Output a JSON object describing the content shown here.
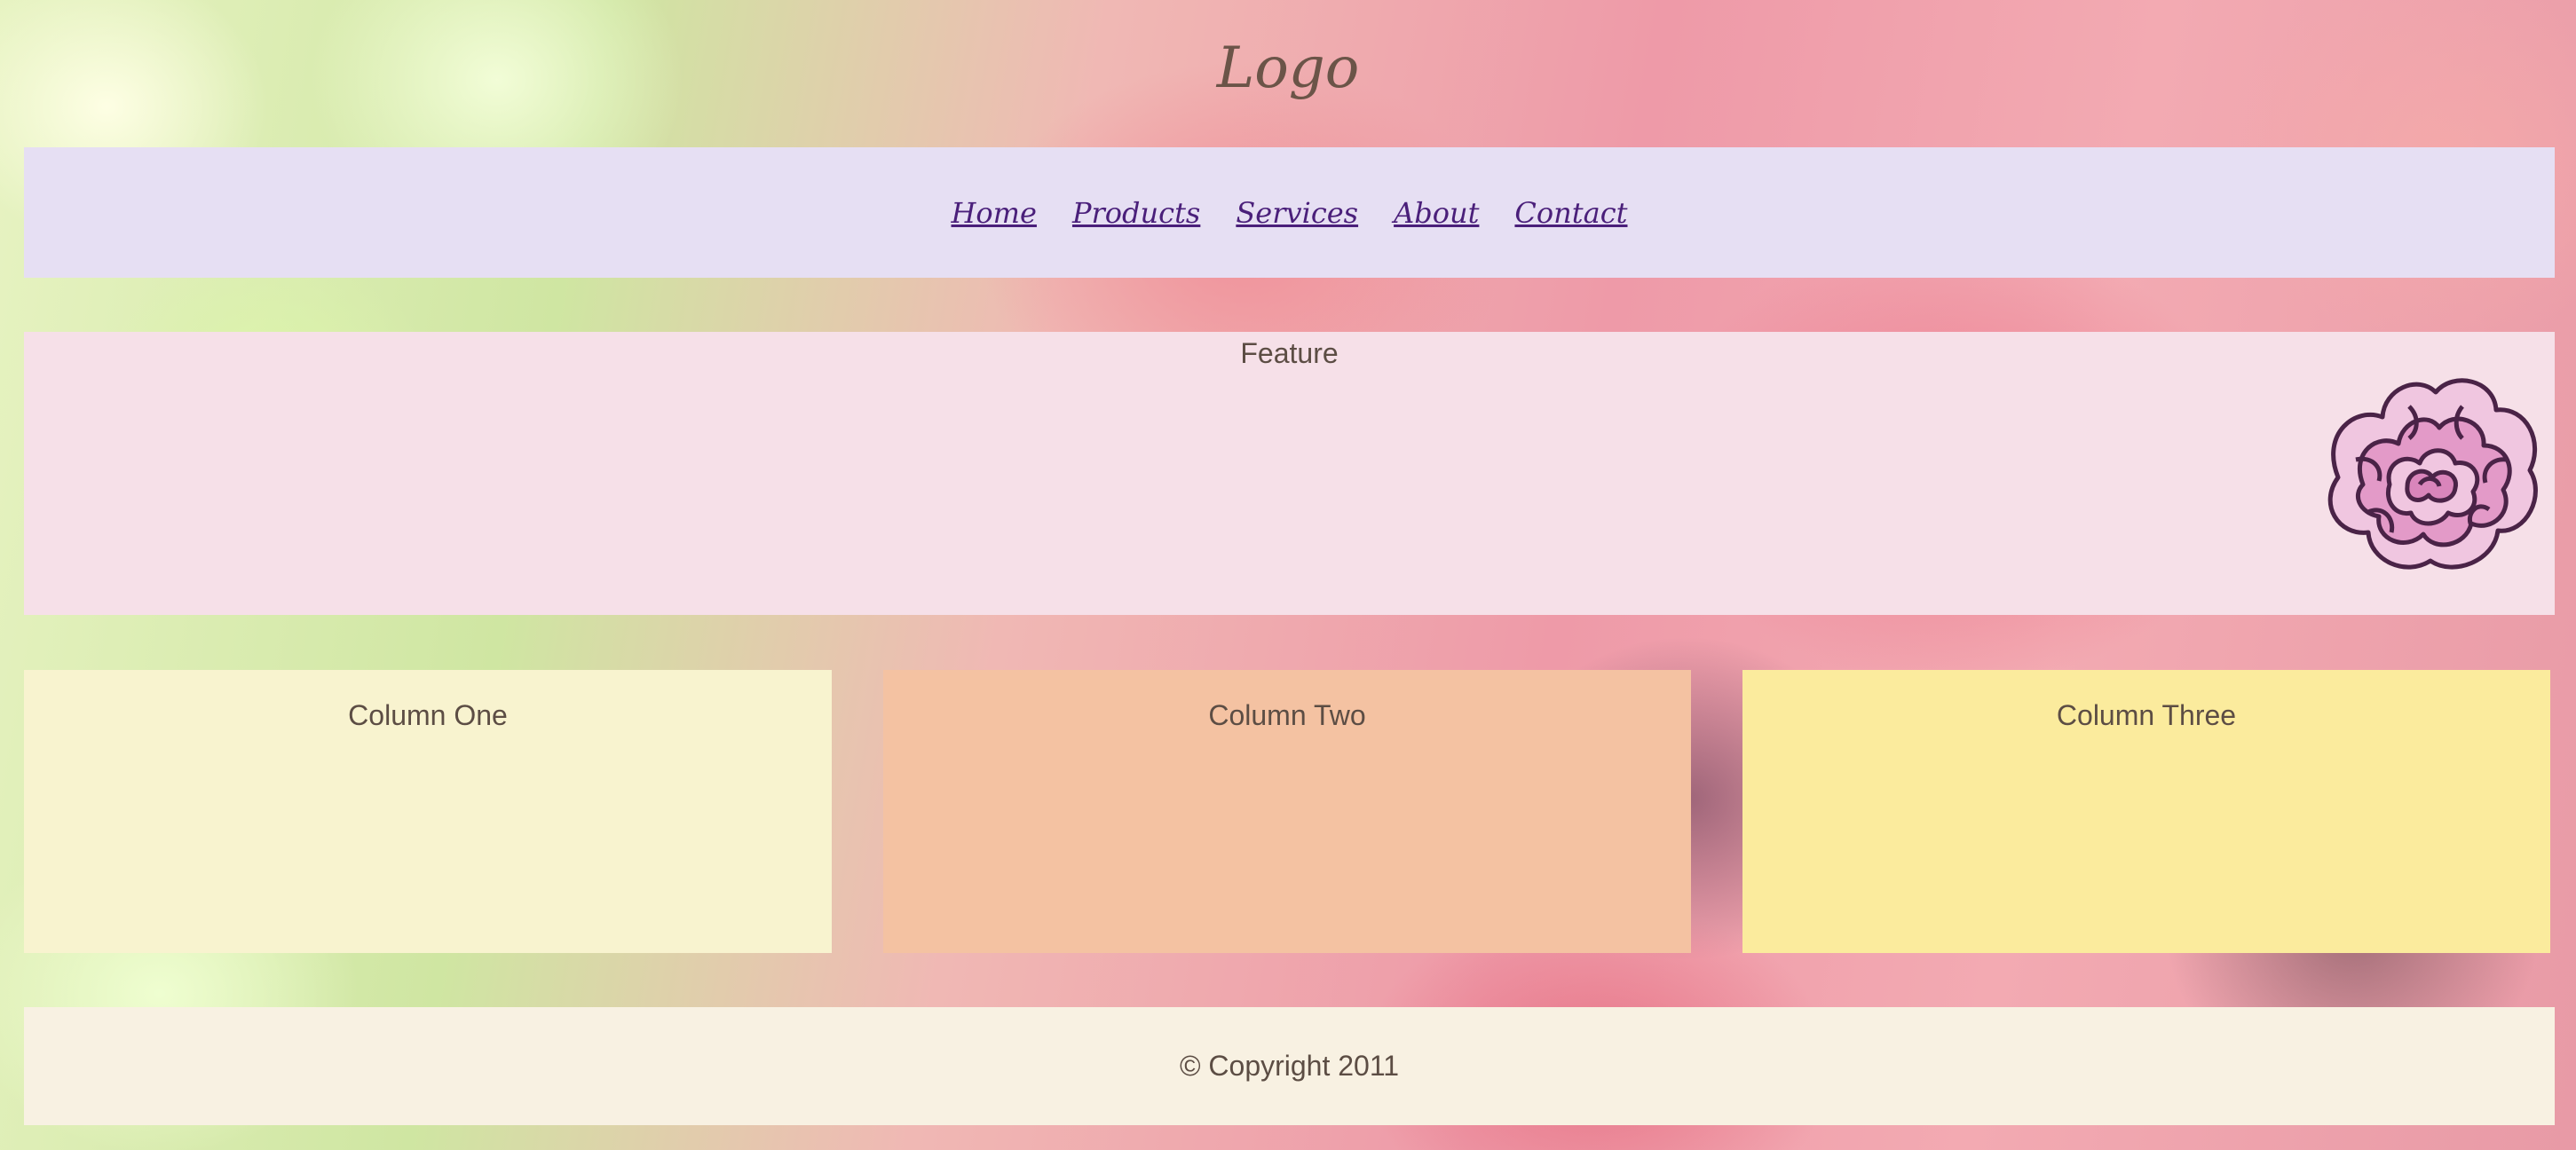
{
  "header": {
    "logo_text": "Logo"
  },
  "nav": {
    "items": [
      {
        "label": "Home"
      },
      {
        "label": "Products"
      },
      {
        "label": "Services"
      },
      {
        "label": "About"
      },
      {
        "label": "Contact"
      }
    ]
  },
  "feature": {
    "title": "Feature",
    "image_icon": "rose-icon"
  },
  "columns": [
    {
      "title": "Column One",
      "color": "#f8f3cf"
    },
    {
      "title": "Column Two",
      "color": "#f4c2a2"
    },
    {
      "title": "Column Three",
      "color": "#fbeb9d"
    }
  ],
  "footer": {
    "text": "© Copyright 2011"
  },
  "colors": {
    "nav_bg": "#e6dff3",
    "nav_link": "#4a1f7a",
    "feature_bg": "#f6e0e8",
    "footer_bg": "#f8f1e2",
    "text": "#5c4d44"
  }
}
